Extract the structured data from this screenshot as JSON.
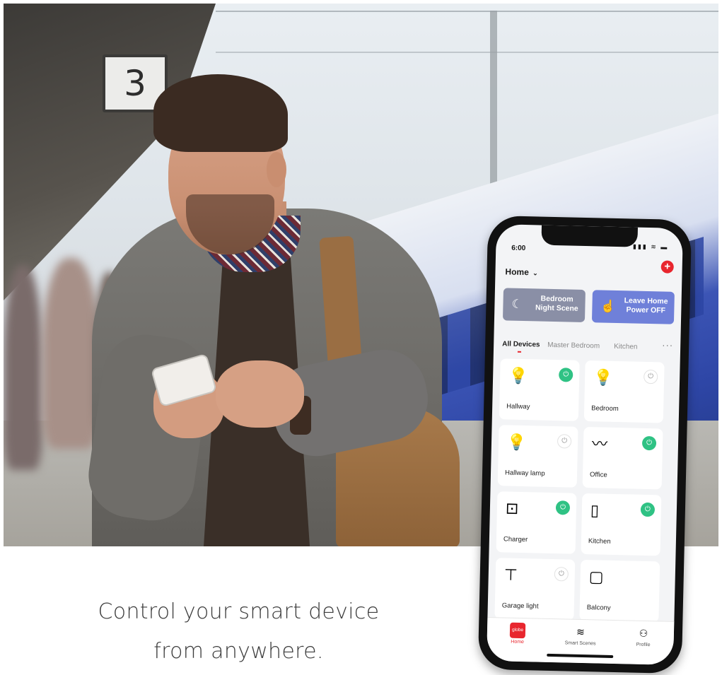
{
  "photo": {
    "platform_number": "3"
  },
  "caption": {
    "line1": "Control your smart device",
    "line2": "from anywhere."
  },
  "phone": {
    "status_time": "6:00",
    "status_icons": "▮▮▮ ≋ ▬",
    "header": {
      "home_label": "Home",
      "home_chevron": "⌄",
      "add_label": "+"
    },
    "scenes": [
      {
        "icon": "☾",
        "icon_name": "moon-icon",
        "label": "Bedroom\nNight Scene",
        "color": "#8a8fa6"
      },
      {
        "icon": "☝",
        "icon_name": "tap-hand-icon",
        "label": "Leave Home\nPower OFF",
        "color": "#6f80d9"
      }
    ],
    "tabs": [
      "All Devices",
      "Master Bedroom",
      "Kitchen"
    ],
    "tabs_more": "···",
    "devices": [
      {
        "name": "Hallway",
        "icon": "💡",
        "icon_name": "bulb-icon",
        "power": "on"
      },
      {
        "name": "Bedroom",
        "icon": "💡",
        "icon_name": "bulb-icon",
        "power": "off"
      },
      {
        "name": "Hallway lamp",
        "icon": "💡",
        "icon_name": "bulb-icon",
        "power": "off"
      },
      {
        "name": "Office",
        "icon": "〰",
        "icon_name": "led-strip-icon",
        "power": "on"
      },
      {
        "name": "Charger",
        "icon": "⊡",
        "icon_name": "outlet-icon",
        "power": "on"
      },
      {
        "name": "Kitchen",
        "icon": "▯",
        "icon_name": "wall-switch-icon",
        "power": "on"
      },
      {
        "name": "Garage light",
        "icon": "⊤",
        "icon_name": "flood-light-icon",
        "power": "off"
      },
      {
        "name": "Balcony",
        "icon": "▢",
        "icon_name": "doorbell-icon",
        "power": null
      }
    ],
    "power_glyph": "⏻",
    "tabbar": {
      "home_logo": "globe",
      "home": "Home",
      "scenes": "Smart Scenes",
      "scenes_icon": "≋",
      "profile": "Profile",
      "profile_icon": "⚇"
    },
    "colors": {
      "accent_red": "#e8262e",
      "power_green": "#2fc284",
      "scene_purple": "#6f80d9"
    }
  }
}
